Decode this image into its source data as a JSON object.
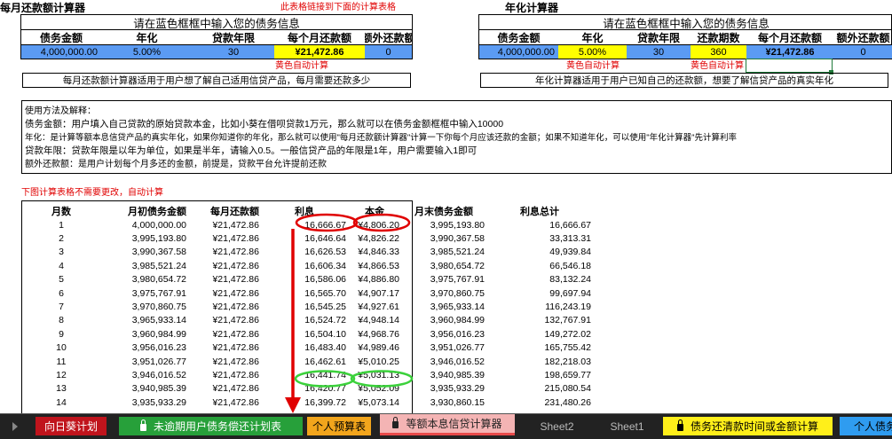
{
  "left_calc": {
    "title": "每月还款额计算器",
    "link_note": "此表格链接到下面的计算表格",
    "banner": "请在蓝色框框中输入您的债务信息",
    "headers": [
      "债务金额",
      "年化",
      "贷款年限",
      "每个月还款额",
      "额外还款额"
    ],
    "values": [
      "4,000,000.00",
      "5.00%",
      "30",
      "¥21,472.86",
      "0"
    ],
    "auto_note": "黄色自动计算",
    "desc": "每月还款额计算器适用于用户想了解自己适用信贷产品，每月需要还款多少"
  },
  "right_calc": {
    "title": "年化计算器",
    "banner": "请在蓝色框框中输入您的债务信息",
    "headers": [
      "债务金额",
      "年化",
      "贷款年限",
      "还款期数",
      "每个月还款额",
      "额外还款额"
    ],
    "values": [
      "4,000,000.00",
      "5.00%",
      "30",
      "360",
      "¥21,472.86",
      "0"
    ],
    "auto_note_1": "黄色自动计算",
    "auto_note_2": "黄色自动计算",
    "desc": "年化计算器适用于用户已知自己的还款额，想要了解信贷产品的真实年化"
  },
  "instructions": {
    "line1": "使用方法及解释：",
    "line2": "债务金额：用户填入自己贷款的原始贷款本金，比如小葵在借呗贷款1万元，那么就可以在债务金额框框中输入10000",
    "line3": "年化：是计算等额本息信贷产品的真实年化，如果你知道你的年化，那么就可以使用\"每月还款额计算器\"计算一下你每个月应该还款的金额；如果不知道年化，可以使用\"年化计算器\"先计算利率",
    "line4": "贷款年限：贷款年限是以年为单位，如果是半年，请输入0.5。一般信贷产品的年限是1年，用户需要输入1即可",
    "line5": "额外还款额：是用户计划每个月多还的金额，前提是，贷款平台允许提前还款"
  },
  "table_note": "下图计算表格不需要更改，自动计算",
  "schedule": {
    "headers": [
      "月数",
      "月初债务金额",
      "每月还款额",
      "利息",
      "本金",
      "月末债务金额",
      "利息总计"
    ],
    "rows": [
      [
        "1",
        "4,000,000.00",
        "¥21,472.86",
        "16,666.67",
        "¥4,806.20",
        "3,995,193.80",
        "16,666.67"
      ],
      [
        "2",
        "3,995,193.80",
        "¥21,472.86",
        "16,646.64",
        "¥4,826.22",
        "3,990,367.58",
        "33,313.31"
      ],
      [
        "3",
        "3,990,367.58",
        "¥21,472.86",
        "16,626.53",
        "¥4,846.33",
        "3,985,521.24",
        "49,939.84"
      ],
      [
        "4",
        "3,985,521.24",
        "¥21,472.86",
        "16,606.34",
        "¥4,866.53",
        "3,980,654.72",
        "66,546.18"
      ],
      [
        "5",
        "3,980,654.72",
        "¥21,472.86",
        "16,586.06",
        "¥4,886.80",
        "3,975,767.91",
        "83,132.24"
      ],
      [
        "6",
        "3,975,767.91",
        "¥21,472.86",
        "16,565.70",
        "¥4,907.17",
        "3,970,860.75",
        "99,697.94"
      ],
      [
        "7",
        "3,970,860.75",
        "¥21,472.86",
        "16,545.25",
        "¥4,927.61",
        "3,965,933.14",
        "116,243.19"
      ],
      [
        "8",
        "3,965,933.14",
        "¥21,472.86",
        "16,524.72",
        "¥4,948.14",
        "3,960,984.99",
        "132,767.91"
      ],
      [
        "9",
        "3,960,984.99",
        "¥21,472.86",
        "16,504.10",
        "¥4,968.76",
        "3,956,016.23",
        "149,272.02"
      ],
      [
        "10",
        "3,956,016.23",
        "¥21,472.86",
        "16,483.40",
        "¥4,989.46",
        "3,951,026.77",
        "165,755.42"
      ],
      [
        "11",
        "3,951,026.77",
        "¥21,472.86",
        "16,462.61",
        "¥5,010.25",
        "3,946,016.52",
        "182,218.03"
      ],
      [
        "12",
        "3,946,016.52",
        "¥21,472.86",
        "16,441.74",
        "¥5,031.13",
        "3,940,985.39",
        "198,659.77"
      ],
      [
        "13",
        "3,940,985.39",
        "¥21,472.86",
        "16,420.77",
        "¥5,052.09",
        "3,935,933.29",
        "215,080.54"
      ],
      [
        "14",
        "3,935,933.29",
        "¥21,472.86",
        "16,399.72",
        "¥5,073.14",
        "3,930,860.15",
        "231,480.26"
      ]
    ]
  },
  "tabs": [
    {
      "label": "向日葵计划",
      "bg": "#c0141c",
      "fg": "#ffffff",
      "lock": false,
      "active": false
    },
    {
      "label": "未逾期用户债务偿还计划表",
      "bg": "#27a03a",
      "fg": "#ffffff",
      "lock": true,
      "active": false
    },
    {
      "label": "个人预算表",
      "bg": "#f2a51c",
      "fg": "#000000",
      "lock": false,
      "active": false
    },
    {
      "label": "等额本息信贷计算器",
      "bg": "#f4b4b4",
      "fg": "#222222",
      "lock": true,
      "active": true
    },
    {
      "label": "Sheet2",
      "bg": "#222222",
      "fg": "#bbbbbb",
      "lock": false,
      "active": false
    },
    {
      "label": "Sheet1",
      "bg": "#222222",
      "fg": "#bbbbbb",
      "lock": false,
      "active": false
    },
    {
      "label": "债务还清款时间或金额计算",
      "bg": "#ffef1a",
      "fg": "#000000",
      "lock": true,
      "active": false
    },
    {
      "label": "个人债务",
      "bg": "#2f9cf0",
      "fg": "#000000",
      "lock": false,
      "active": false
    }
  ],
  "colors": {
    "blue": "#5b9bf3",
    "yellow": "#ffff00",
    "red": "#e00000",
    "green": "#3bd13b"
  }
}
